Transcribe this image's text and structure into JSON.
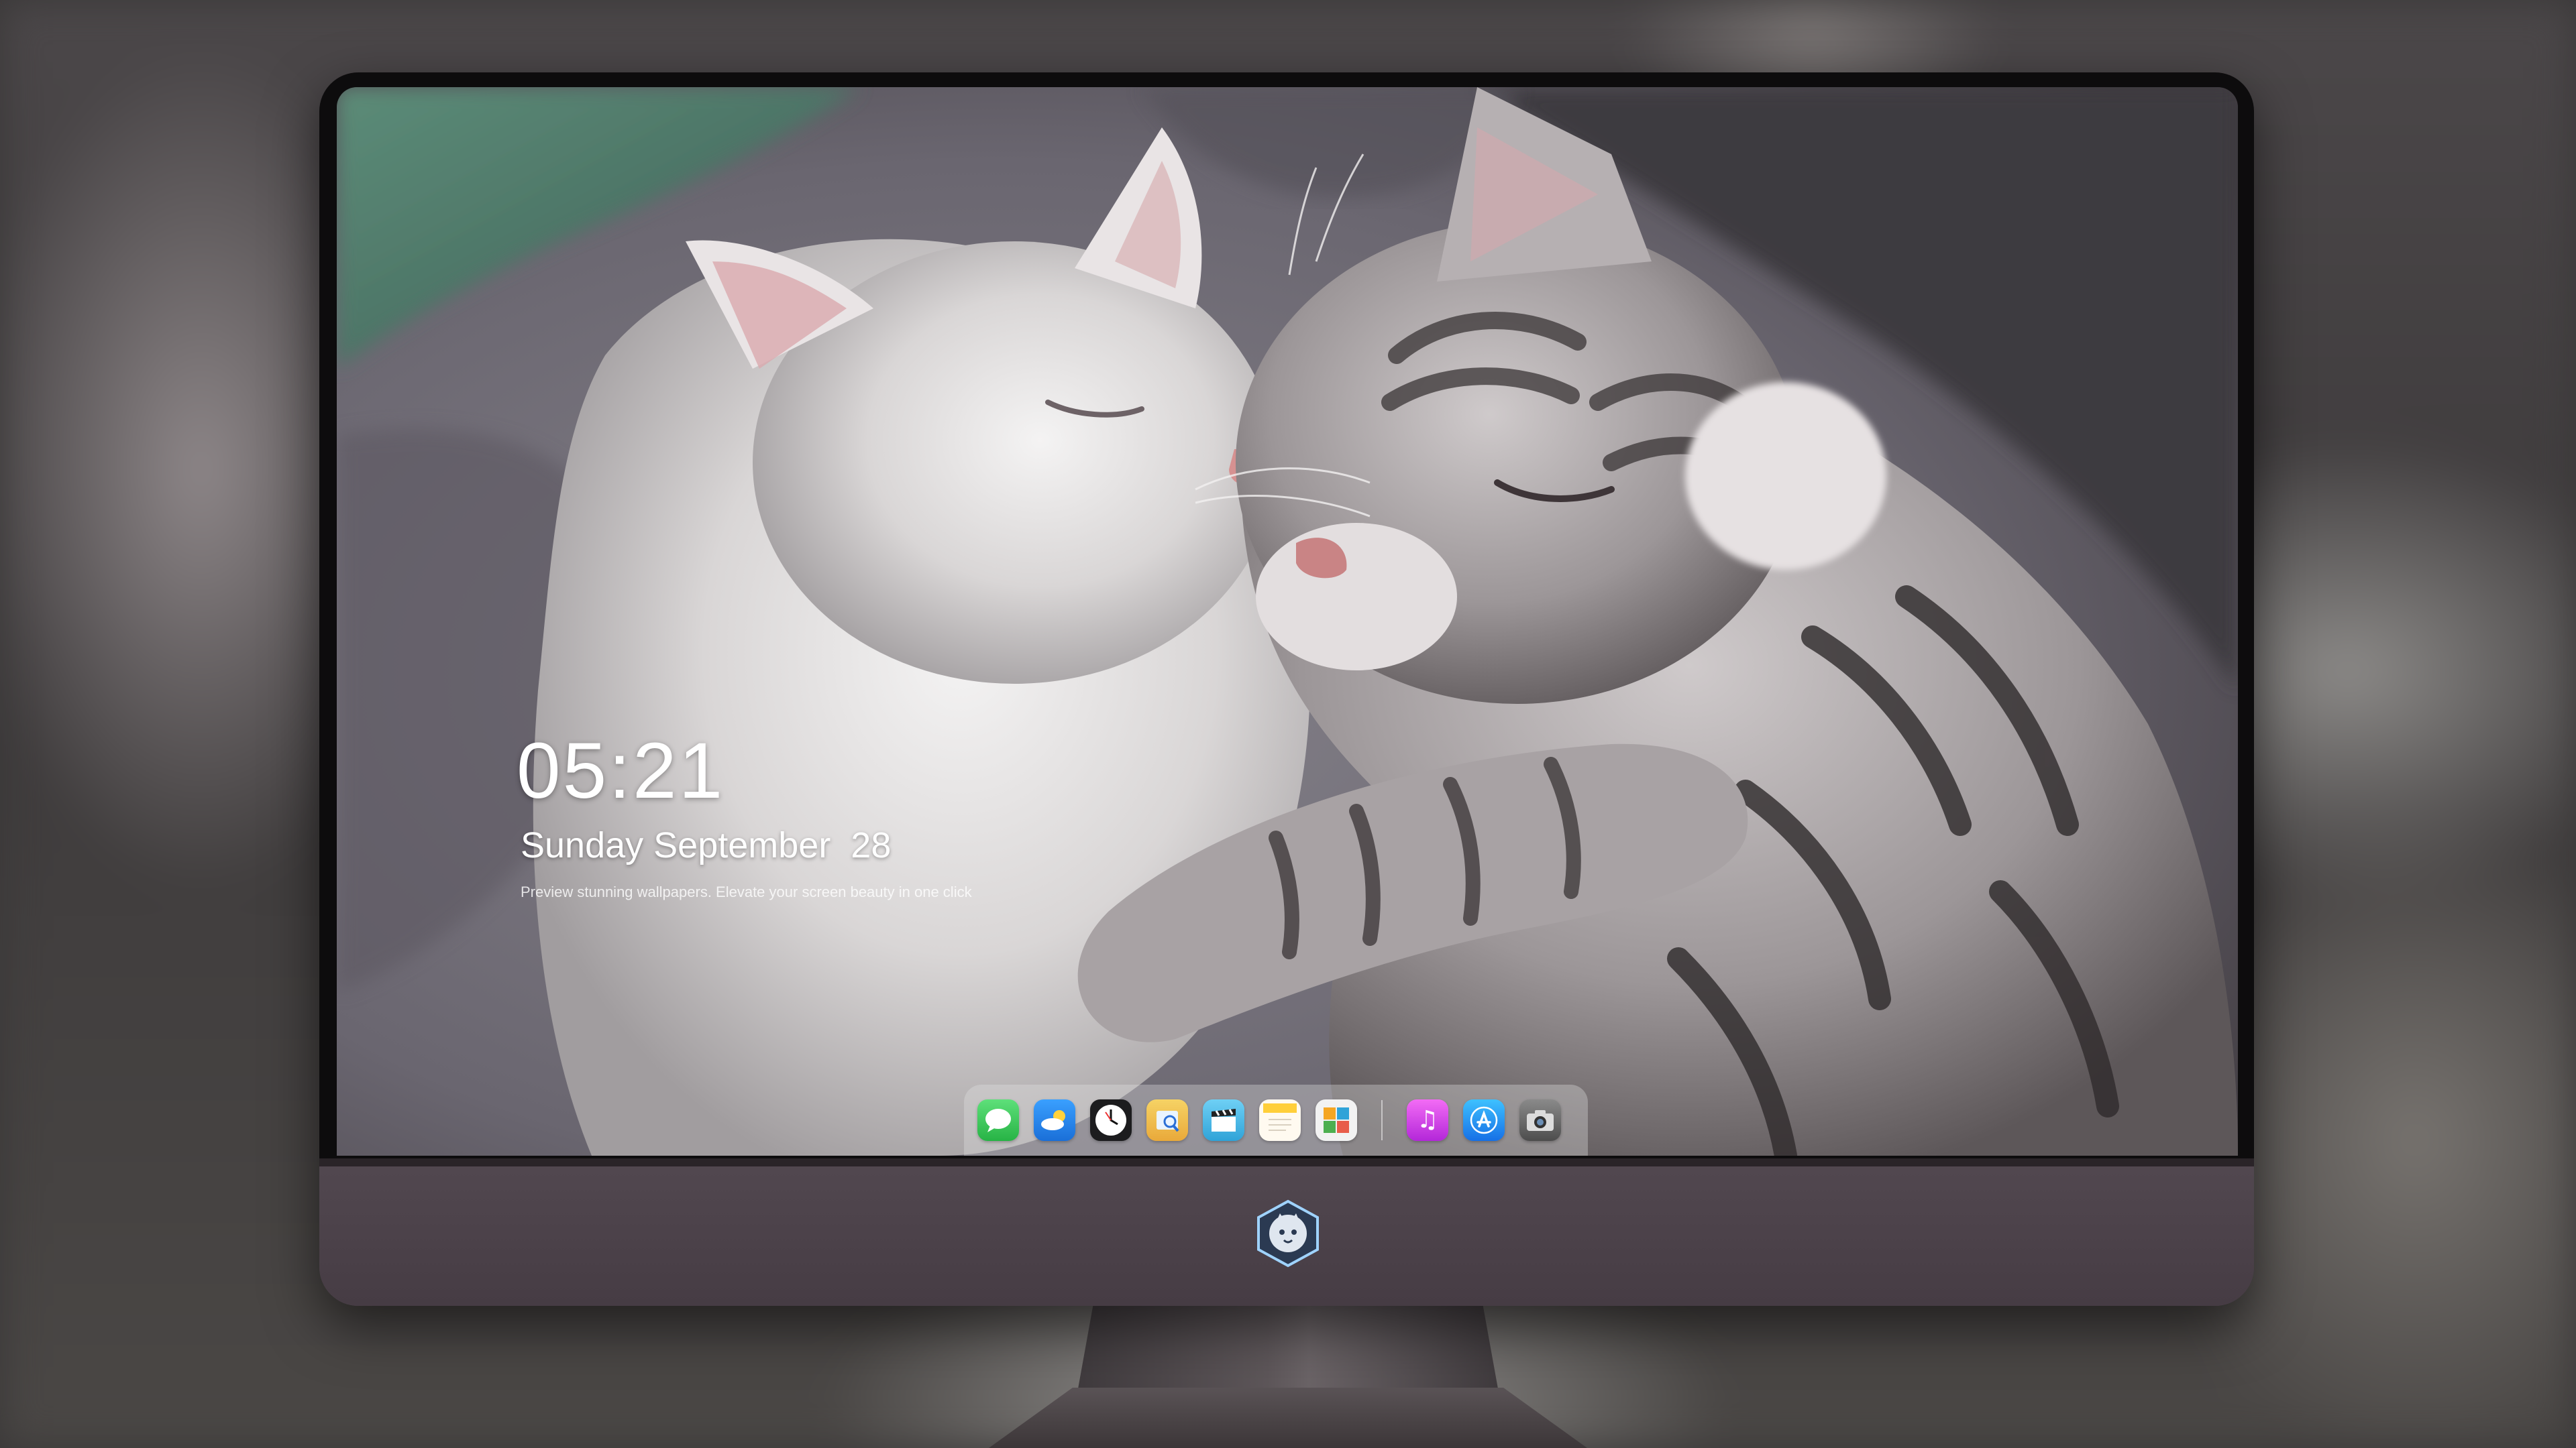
{
  "lockscreen": {
    "time": "05:21",
    "date": "Sunday September  28",
    "tagline": "Preview stunning wallpapers. Elevate your screen beauty in one click"
  },
  "dock": {
    "apps": [
      {
        "name": "Messages",
        "icon": "messages-icon",
        "color": "#34c759"
      },
      {
        "name": "Weather",
        "icon": "weather-icon",
        "color": "#2f8cf0"
      },
      {
        "name": "Clock",
        "icon": "clock-icon",
        "color": "#ffffff"
      },
      {
        "name": "Preview",
        "icon": "preview-icon",
        "color": "#f2c94c"
      },
      {
        "name": "Clips",
        "icon": "clapperboard-icon",
        "color": "#41b6e6"
      },
      {
        "name": "Notes",
        "icon": "notes-icon",
        "color": "#ffd54a"
      },
      {
        "name": "Photo Booth",
        "icon": "photo-grid-icon",
        "color": "#e85d4a"
      },
      {
        "name": "Music",
        "icon": "music-icon",
        "color": "#d946ef"
      },
      {
        "name": "App Store",
        "icon": "app-store-icon",
        "color": "#1e90ff"
      },
      {
        "name": "Camera",
        "icon": "camera-icon",
        "color": "#6b6b6b"
      }
    ]
  },
  "colors": {
    "monitor_body": "#4a4248",
    "bezel": "#0d0c0d",
    "blanket": "#6e6a72"
  }
}
